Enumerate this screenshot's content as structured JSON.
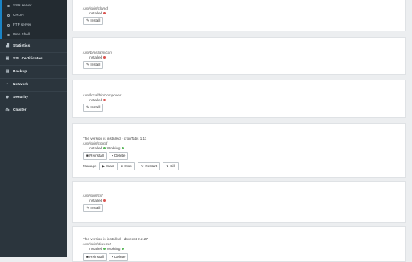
{
  "sidebar": {
    "sub_items": [
      {
        "label": "SSH server"
      },
      {
        "label": "CRON"
      },
      {
        "label": "FTP server"
      },
      {
        "label": "Web Shell"
      }
    ],
    "items": [
      {
        "label": "Statistics",
        "icon": "chart-icon"
      },
      {
        "label": "SSL Certificates",
        "icon": "certificate-icon"
      },
      {
        "label": "Backup",
        "icon": "backup-icon"
      },
      {
        "label": "Network",
        "icon": "network-icon"
      },
      {
        "label": "Security",
        "icon": "shield-icon"
      },
      {
        "label": "Cluster",
        "icon": "cluster-icon"
      }
    ]
  },
  "labels": {
    "installed": "Installed",
    "working": "Working",
    "install": "Install",
    "reinstall": "Reinstall",
    "delete": "Delete",
    "manage": "Manage",
    "start": "Start",
    "stop": "Stop",
    "restart": "Restart",
    "kill": "Kill"
  },
  "cards": {
    "clamd": {
      "path": "/usr/sbin/clamd"
    },
    "clamscan": {
      "path": "/usr/bin/clamscan"
    },
    "composer": {
      "path": "/usr/local/bin/composer"
    },
    "crond": {
      "version": "The version is installed - cronTabs 1.11",
      "path": "/usr/sbin/crond"
    },
    "csf": {
      "path": "/usr/sbin/csf"
    },
    "dovecot": {
      "version": "The version is installed - dovecot 2.2.27",
      "path": "/usr/sbin/dovecot"
    }
  },
  "colors": {
    "sidebar": "#2b353d",
    "accent": "#1a84c6",
    "ok": "#5cb85c",
    "error": "#d9534f"
  }
}
